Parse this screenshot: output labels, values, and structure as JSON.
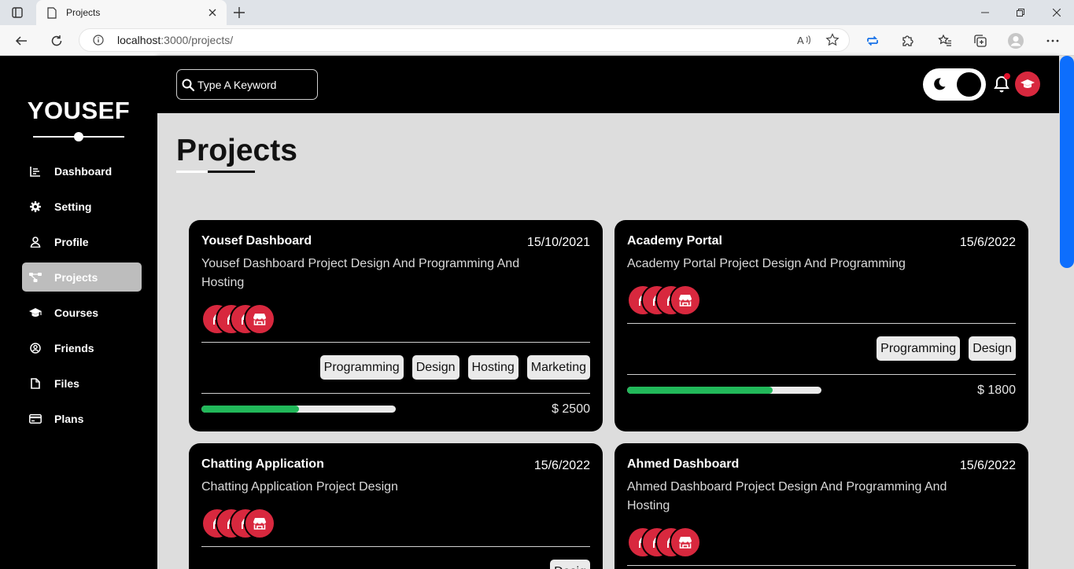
{
  "browser": {
    "tab_title": "Projects",
    "url_host": "localhost",
    "url_path": ":3000/projects/"
  },
  "sidebar": {
    "brand": "YOUSEF",
    "items": [
      {
        "label": "Dashboard",
        "icon": "chart-icon"
      },
      {
        "label": "Setting",
        "icon": "gear-icon"
      },
      {
        "label": "Profile",
        "icon": "user-icon"
      },
      {
        "label": "Projects",
        "icon": "diagram-icon",
        "active": true
      },
      {
        "label": "Courses",
        "icon": "graduation-cap-icon"
      },
      {
        "label": "Friends",
        "icon": "user-circle-icon"
      },
      {
        "label": "Files",
        "icon": "file-icon"
      },
      {
        "label": "Plans",
        "icon": "credit-card-icon"
      }
    ]
  },
  "topbar": {
    "search_placeholder": "Type A Keyword"
  },
  "page": {
    "title": "Projects"
  },
  "projects": [
    {
      "title": "Yousef Dashboard",
      "date": "15/10/2021",
      "description": "Yousef Dashboard Project Design And Programming And Hosting",
      "tags": [
        "Programming",
        "Design",
        "Hosting",
        "Marketing"
      ],
      "progress": 0.5,
      "price": "$ 2500"
    },
    {
      "title": "Academy Portal",
      "date": "15/6/2022",
      "description": "Academy Portal Project Design And Programming",
      "tags": [
        "Programming",
        "Design"
      ],
      "progress": 0.75,
      "price": "$ 1800"
    },
    {
      "title": "Chatting Application",
      "date": "15/6/2022",
      "description": "Chatting Application Project Design",
      "tags": [
        "Desig"
      ]
    },
    {
      "title": "Ahmed Dashboard",
      "date": "15/6/2022",
      "description": "Ahmed Dashboard Project Design And Programming And Hosting"
    }
  ],
  "colors": {
    "accent_red": "#d8283e",
    "progress_green": "#22b85a",
    "scrollbar_blue": "#0d6efd"
  }
}
